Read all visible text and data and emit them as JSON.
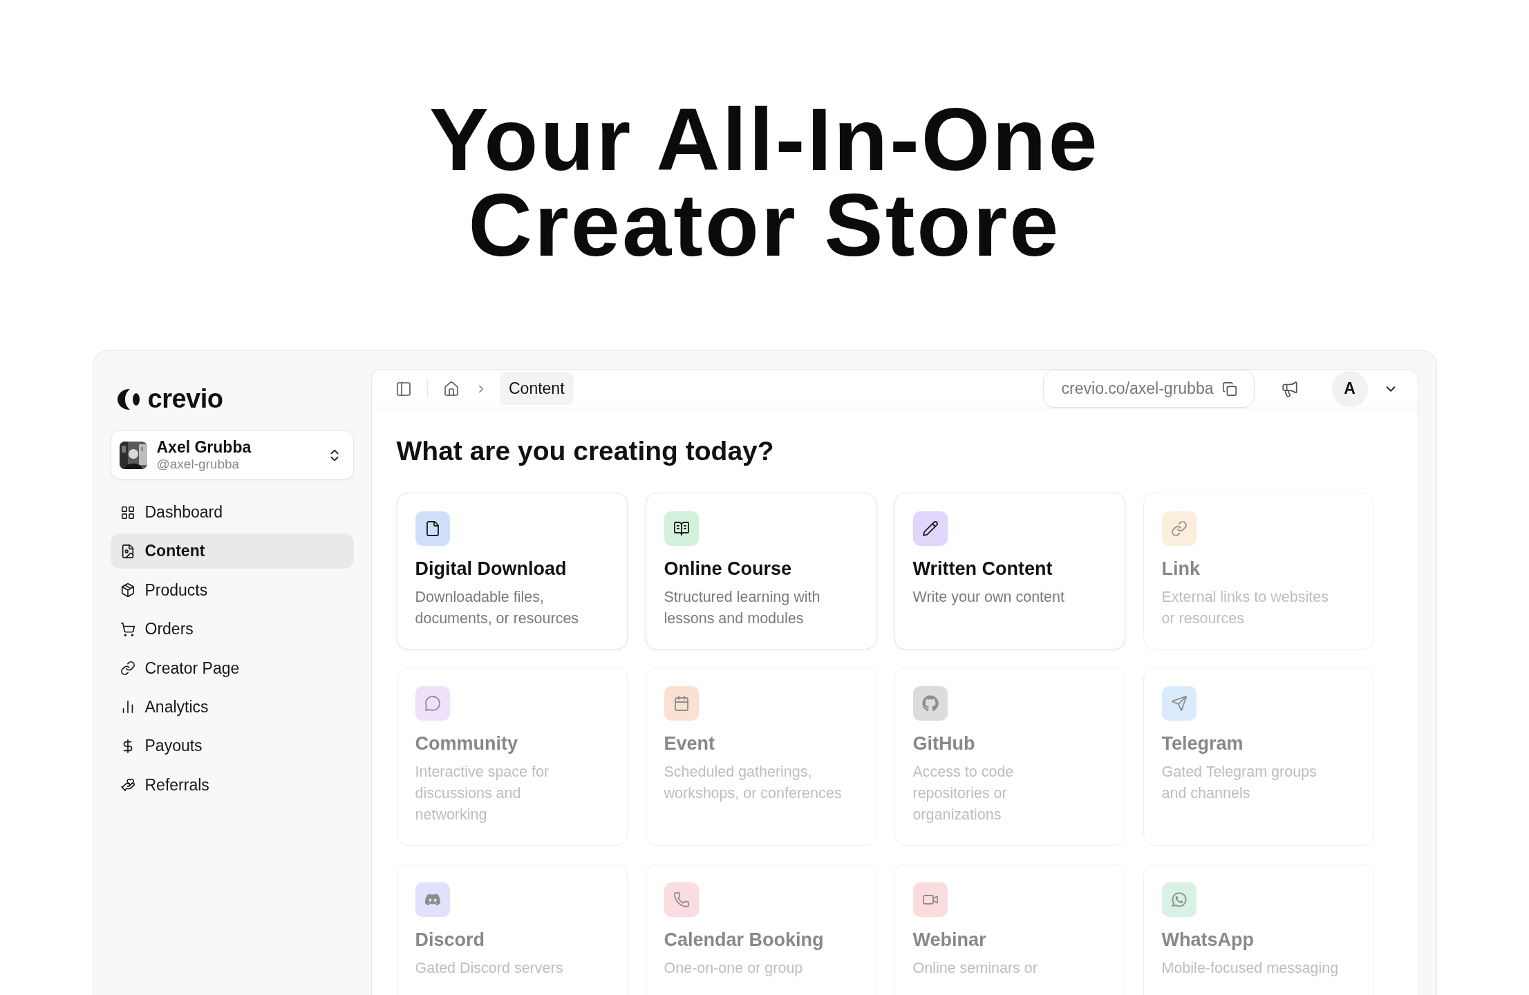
{
  "headline": [
    "Your All-In-One",
    "Creator Store"
  ],
  "brand": {
    "name": "crevio"
  },
  "profile": {
    "name": "Axel Grubba",
    "handle": "@axel-grubba"
  },
  "nav": [
    {
      "label": "Dashboard",
      "selected": false
    },
    {
      "label": "Content",
      "selected": true
    },
    {
      "label": "Products",
      "selected": false
    },
    {
      "label": "Orders",
      "selected": false
    },
    {
      "label": "Creator Page",
      "selected": false
    },
    {
      "label": "Analytics",
      "selected": false
    },
    {
      "label": "Payouts",
      "selected": false
    },
    {
      "label": "Referrals",
      "selected": false
    }
  ],
  "breadcrumb": {
    "current": "Content"
  },
  "store_url": "crevio.co/axel-grubba",
  "account_initial": "A",
  "heading": "What are you creating today?",
  "cards": [
    {
      "title": "Digital Download",
      "description": "Downloadable files, documents, or resources",
      "color": "#cfe0fb",
      "faded": false
    },
    {
      "title": "Online Course",
      "description": "Structured learning with lessons and modules",
      "color": "#d3f0da",
      "faded": false
    },
    {
      "title": "Written Content",
      "description": "Write your own content",
      "color": "#e0d5fb",
      "faded": false
    },
    {
      "title": "Link",
      "description": "External links to websites or resources",
      "color": "#fbecd6",
      "faded": true
    },
    {
      "title": "Community",
      "description": "Interactive space for discussions and networking",
      "color": "#ecdcfb",
      "faded": true
    },
    {
      "title": "Event",
      "description": "Scheduled gatherings, workshops, or conferences",
      "color": "#fbdccb",
      "faded": true
    },
    {
      "title": "GitHub",
      "description": "Access to code repositories or organizations",
      "color": "#d6d6d6",
      "faded": true
    },
    {
      "title": "Telegram",
      "description": "Gated Telegram groups and channels",
      "color": "#d6e8fb",
      "faded": true
    },
    {
      "title": "Discord",
      "description": "Gated Discord servers",
      "color": "#dcdcfb",
      "faded": true
    },
    {
      "title": "Calendar Booking",
      "description": "One-on-one or group",
      "color": "#fbd6dc",
      "faded": true
    },
    {
      "title": "Webinar",
      "description": "Online seminars or",
      "color": "#fbd6d8",
      "faded": true
    },
    {
      "title": "WhatsApp",
      "description": "Mobile-focused messaging",
      "color": "#d3f0df",
      "faded": true
    }
  ]
}
